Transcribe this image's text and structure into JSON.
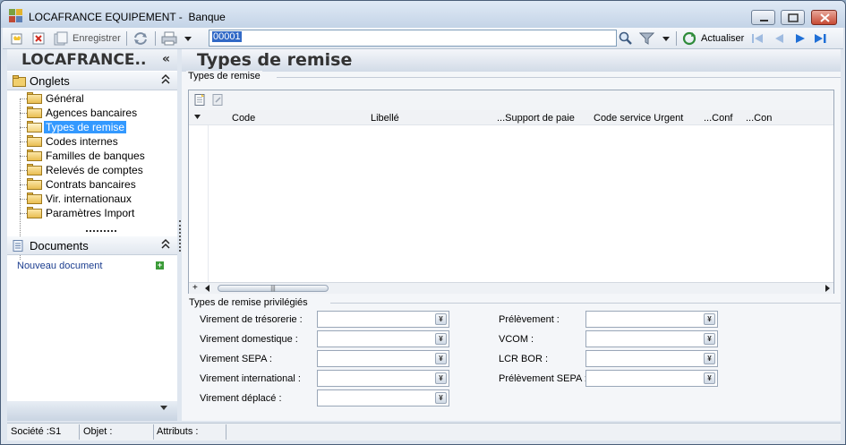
{
  "window": {
    "title": "LOCAFRANCE EQUIPEMENT -  Banque"
  },
  "toolbar": {
    "save_label": "Enregistrer",
    "record_value": "00001",
    "refresh_label": "Actualiser"
  },
  "sidebar": {
    "company_name": "LOCAFRANCE..",
    "collapse_glyph": "«",
    "onglets_title": "Onglets",
    "items": [
      {
        "label": "Général"
      },
      {
        "label": "Agences bancaires"
      },
      {
        "label": "Types de remise"
      },
      {
        "label": "Codes internes"
      },
      {
        "label": "Familles de banques"
      },
      {
        "label": "Relevés de comptes"
      },
      {
        "label": "Contrats bancaires"
      },
      {
        "label": "Vir. internationaux"
      },
      {
        "label": "Paramètres Import"
      }
    ],
    "selected_index": 2,
    "documents_title": "Documents",
    "new_document_label": "Nouveau document"
  },
  "main": {
    "page_title": "Types de remise",
    "grid_group_title": "Types de remise",
    "columns": [
      "Code",
      "Libellé",
      "...Support de paie",
      "Code service Urgent",
      "...Conf",
      "...Con"
    ],
    "add_row_glyph": "+",
    "privileged_group_title": "Types de remise privilégiés",
    "fields_left": [
      {
        "label": "Virement de trésorerie :",
        "value": ""
      },
      {
        "label": "Virement domestique :",
        "value": ""
      },
      {
        "label": "Virement SEPA :",
        "value": ""
      },
      {
        "label": "Virement international :",
        "value": ""
      },
      {
        "label": "Virement déplacé :",
        "value": ""
      }
    ],
    "fields_right": [
      {
        "label": "Prélèvement :",
        "value": ""
      },
      {
        "label": "VCOM :",
        "value": ""
      },
      {
        "label": "LCR BOR :",
        "value": ""
      },
      {
        "label": "Prélèvement SEPA :",
        "value": ""
      }
    ]
  },
  "status_bar": {
    "company": "Société :S1",
    "object": "Objet :",
    "attributes": "Attributs :"
  },
  "colors": {
    "selection": "#3399ff",
    "record_highlight": "#3169c6",
    "nav_arrow": "#1f6fd6",
    "close_button": "#c74a34"
  }
}
